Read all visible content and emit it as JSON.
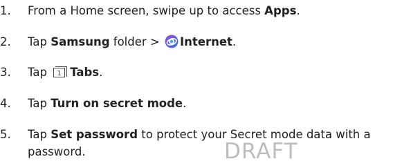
{
  "steps": [
    {
      "number": "1.",
      "pre": "From a Home screen, swipe up to access ",
      "bold": "Apps",
      "post": "."
    },
    {
      "number": "2.",
      "pre": "Tap ",
      "bold1": "Samsung",
      "mid": " folder > ",
      "icon": "samsung-internet-icon",
      "bold2": "Internet",
      "post": "."
    },
    {
      "number": "3.",
      "pre": "Tap ",
      "icon": "tabs-icon",
      "icon_text": "1",
      "bold": "Tabs",
      "post": "."
    },
    {
      "number": "4.",
      "pre": "Tap ",
      "bold": "Turn on secret mode",
      "post": "."
    },
    {
      "number": "5.",
      "pre": "Tap ",
      "bold": "Set password",
      "post": " to protect your Secret mode data with a",
      "continuation": "password."
    }
  ],
  "watermark": "DRAFT",
  "colors": {
    "text": "#222222",
    "watermark": "#bdbdbd",
    "icon_purple": "#6a3fd0",
    "icon_blue": "#2d9bf0"
  }
}
